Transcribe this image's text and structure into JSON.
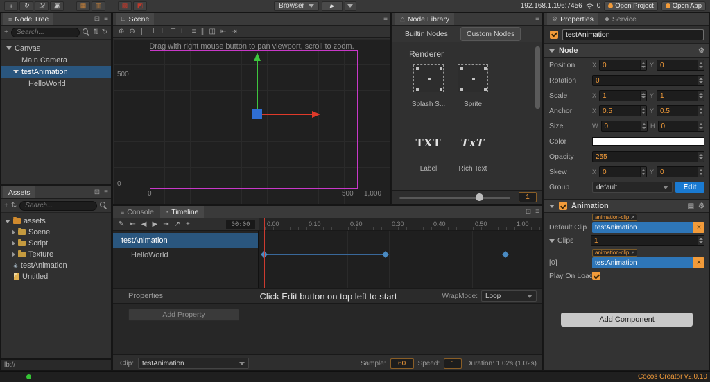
{
  "colors": {
    "accent": "#f29b3a",
    "selection": "#2a567e",
    "clipfield": "#2e76b8",
    "edit_blue": "#1a7ad1",
    "keyframe": "#4a8ac2",
    "playhead": "#cc3b30",
    "design_border": "#c838c8",
    "node_color": "#ffffff",
    "ok_green": "#35c435"
  },
  "icons": {
    "move": "+",
    "rotate": "↻",
    "scale": "⇲",
    "rect": "▣",
    "atlas1": "▦",
    "atlas2": "▥",
    "red1": "▩",
    "red2": "◩",
    "play": "▶",
    "float": "⊡",
    "menu": "≡",
    "add": "+",
    "refresh": "↻",
    "sort": "⇅",
    "pencil": "✎",
    "to_start": "⇤",
    "prev": "◀",
    "next": "▶",
    "to_end": "⇥",
    "share": "↗",
    "gear": "⚙",
    "copy": "▤",
    "close": "×",
    "console": "≡",
    "clock": "◔",
    "library": "△",
    "scene_doc": "⊡",
    "wrench": "⚙",
    "service": "◆"
  },
  "toolbar": {
    "browser_label": "Browser",
    "address": "192.168.1.196:7456",
    "connection_count": "0",
    "open_project_label": "Open Project",
    "open_app_label": "Open App"
  },
  "node_tree": {
    "title": "Node Tree",
    "search_placeholder": "Search...",
    "items": [
      {
        "label": "Canvas"
      },
      {
        "label": "Main Camera"
      },
      {
        "label": "testAnimation"
      },
      {
        "label": "HelloWorld"
      }
    ]
  },
  "assets": {
    "title": "Assets",
    "search_placeholder": "Search...",
    "items": [
      {
        "label": "assets"
      },
      {
        "label": "Scene"
      },
      {
        "label": "Script"
      },
      {
        "label": "Texture"
      },
      {
        "label": "testAnimation"
      },
      {
        "label": "Untitled"
      }
    ],
    "path": "lb://"
  },
  "scene": {
    "tab_label": "Scene",
    "hint": "Drag with right mouse button to pan viewport, scroll to zoom.",
    "toolbar_icons": [
      "⊕",
      "⊖",
      "∣",
      "⊣",
      "⊥",
      "⊤",
      "⊢",
      "≡",
      "∥",
      "◫",
      "⇤",
      "⇥"
    ],
    "ruler_left_top": "500",
    "ruler_left_bottom": "0",
    "ruler_bottom": [
      "0",
      "500",
      "1,000"
    ]
  },
  "node_library": {
    "title": "Node Library",
    "tab_builtin": "Builtin Nodes",
    "tab_custom": "Custom Nodes",
    "section_title": "Renderer",
    "items": [
      {
        "label": "Splash S..."
      },
      {
        "label": "Sprite"
      },
      {
        "label": "Label",
        "glyph": "TXT"
      },
      {
        "label": "Rich Text",
        "glyph": "TxT"
      }
    ],
    "slider_value": "1"
  },
  "timeline": {
    "tab_console": "Console",
    "tab_timeline": "Timeline",
    "time_display": "00:00",
    "ruler": [
      "0:00",
      "0:10",
      "0:20",
      "0:30",
      "0:40",
      "0:50",
      "1:00"
    ],
    "rows": [
      {
        "label": "testAnimation"
      },
      {
        "label": "HelloWorld"
      }
    ],
    "keyframe_times": [
      "0:00",
      "0:29",
      "0:58"
    ],
    "properties_label": "Properties",
    "hint": "Click Edit button on top left to start",
    "wrapmode_label": "WrapMode:",
    "wrapmode_value": "Loop",
    "add_property_label": "Add Property",
    "clip_label": "Clip:",
    "clip_value": "testAnimation",
    "sample_label": "Sample:",
    "sample_value": "60",
    "speed_label": "Speed:",
    "speed_value": "1",
    "duration_text": "Duration: 1.02s (1.02s)"
  },
  "properties": {
    "tab_properties": "Properties",
    "tab_service": "Service",
    "node_name": "testAnimation",
    "node": {
      "title": "Node",
      "position": {
        "label": "Position",
        "x_label": "X",
        "x": "0",
        "y_label": "Y",
        "y": "0"
      },
      "rotation": {
        "label": "Rotation",
        "value": "0"
      },
      "scale": {
        "label": "Scale",
        "x_label": "X",
        "x": "1",
        "y_label": "Y",
        "y": "1"
      },
      "anchor": {
        "label": "Anchor",
        "x_label": "X",
        "x": "0.5",
        "y_label": "Y",
        "y": "0.5"
      },
      "size": {
        "label": "Size",
        "w_label": "W",
        "w": "0",
        "h_label": "H",
        "h": "0"
      },
      "color": {
        "label": "Color",
        "value": "#FFFFFF"
      },
      "opacity": {
        "label": "Opacity",
        "value": "255"
      },
      "skew": {
        "label": "Skew",
        "x_label": "X",
        "x": "0",
        "y_label": "Y",
        "y": "0"
      },
      "group": {
        "label": "Group",
        "value": "default",
        "edit_label": "Edit"
      }
    },
    "animation": {
      "title": "Animation",
      "badge": "animation-clip",
      "default_clip_label": "Default Clip",
      "default_clip_value": "testAnimation",
      "clips_label": "Clips",
      "clips_value": "1",
      "item0_label": "[0]",
      "item0_value": "testAnimation",
      "play_on_load_label": "Play On Load"
    },
    "add_component_label": "Add Component"
  },
  "footer": {
    "version": "Cocos Creator v2.0.10"
  }
}
